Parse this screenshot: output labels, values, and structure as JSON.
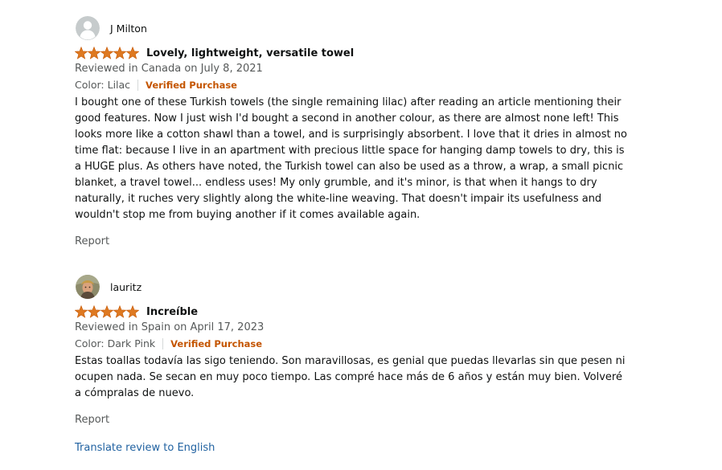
{
  "colors": {
    "star": "#de7921",
    "verified": "#c45500",
    "link": "#2162a1",
    "muted": "#565959",
    "text": "#0f1111"
  },
  "reviews": [
    {
      "profile_name": "J Milton",
      "avatar_icon": "default-user-avatar-icon",
      "rating": 5,
      "title": "Lovely, lightweight, versatile towel",
      "date": "Reviewed in Canada on July 8, 2021",
      "format": "Color: Lilac",
      "verified": "Verified Purchase",
      "body": "I bought one of these Turkish towels (the single remaining lilac) after reading an article mentioning their good features. Now I just wish I'd bought a second in another colour, as there are almost none left! This looks more like a cotton shawl than a towel, and is surprisingly absorbent. I love that it dries in almost no time flat: because I live in an apartment with precious little space for hanging damp towels to dry, this is a HUGE plus. As others have noted, the Turkish towel can also be used as a throw, a wrap, a small picnic blanket, a travel towel... endless uses! My only grumble, and it's minor, is that when it hangs to dry naturally, it ruches very slightly along the white-line weaving. That doesn't impair its usefulness and wouldn't stop me from buying another if it comes available again.",
      "report": "Report"
    },
    {
      "profile_name": "lauritz",
      "avatar_icon": "user-photo-avatar-icon",
      "rating": 5,
      "title": "Increíble",
      "date": "Reviewed in Spain on April 17, 2023",
      "format": "Color: Dark Pink",
      "verified": "Verified Purchase",
      "body": "Estas toallas todavía las sigo teniendo. Son maravillosas, es genial que puedas llevarlas sin que pesen ni ocupen nada. Se secan en muy poco tiempo. Las compré hace más de 6 años y están muy bien. Volveré a cómpralas de nuevo.",
      "report": "Report"
    }
  ],
  "translate_link": "Translate review to English"
}
